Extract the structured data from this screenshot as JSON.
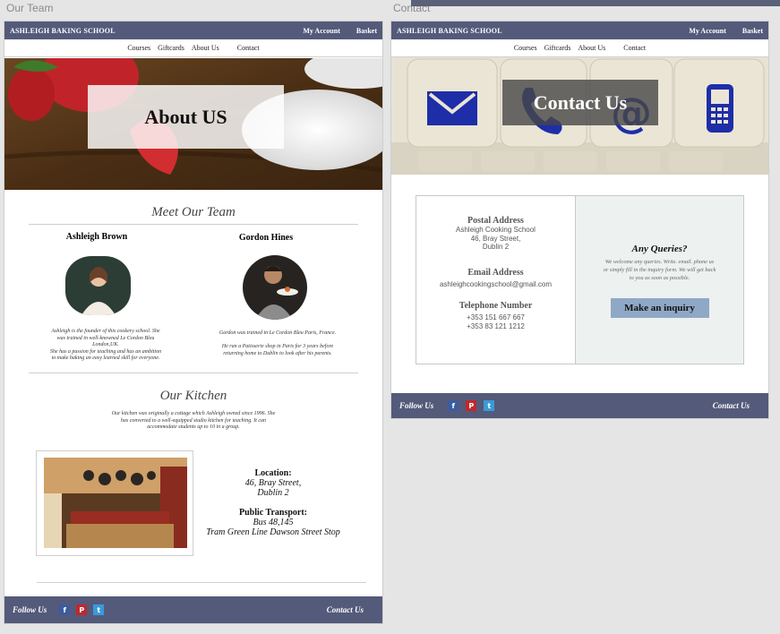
{
  "labels": {
    "left_artboard": "Our Team",
    "right_artboard": "Contact"
  },
  "nav": {
    "brand": "ASHLEIGH BAKING SCHOOL",
    "account": "My Account",
    "basket": "Basket"
  },
  "subnav": {
    "courses": "Courses",
    "giftcards": "Giftcards",
    "about": "About Us",
    "contact": "Contact"
  },
  "about": {
    "hero_title": "About US",
    "meet_heading": "Meet Our Team",
    "member1": {
      "name": "Ashleigh Brown",
      "bio_lines": [
        "Ashleigh is the founder of this cookery school.  She",
        "was trained in well-knowned Le Cordon Bleu",
        "London,UK.",
        "She has a passion for teaching and has an ambition",
        "to make baking an easy learned skill for everyone."
      ]
    },
    "member2": {
      "name": "Gordon Hines",
      "bio_lines": [
        "Gordon was trained in Le Cordon Bleu Paris, France.",
        "",
        "He ran a Patisserie shop in Paris for  3 years before",
        "returning home to Dublin to look after his parents."
      ]
    },
    "kitchen_heading": "Our Kitchen",
    "kitchen_lines": [
      "Our kitchen was originally a cottage which Ashleigh owned since 1996.  She",
      "has converted to a well-equipped studio kitchen for teaching.  It can",
      "accommodate students up to 10 in a group."
    ],
    "location_label": "Location:",
    "location_lines": [
      "46, Bray Street,",
      "Dublin 2"
    ],
    "transport_label": "Public Transport:",
    "transport_lines": [
      "Bus 48,145",
      "Tram Green Line Dawson Street Stop"
    ]
  },
  "contact": {
    "hero_title": "Contact Us",
    "postal_label": "Postal Address",
    "postal_lines": [
      "Ashleigh Cooking School",
      "46, Bray Street,",
      "Dublin 2"
    ],
    "email_label": "Email Address",
    "email": "ashleighcookingschool@gmail.com",
    "phone_label": "Telephone Number",
    "phone_lines": [
      "+353 151 667 667",
      "+353 83 121 1212"
    ],
    "queries_title": "Any Queries?",
    "queries_lines": [
      "We welcome any queries. Write. email. phone us",
      "or simply fill in the inquiry form.  We will get back",
      "to you as soon as possible."
    ],
    "inquiry_button": "Make an inquiry"
  },
  "footer": {
    "follow": "Follow Us",
    "contact": "Contact Us",
    "fb": "f",
    "pin": "P",
    "tw": "t"
  }
}
